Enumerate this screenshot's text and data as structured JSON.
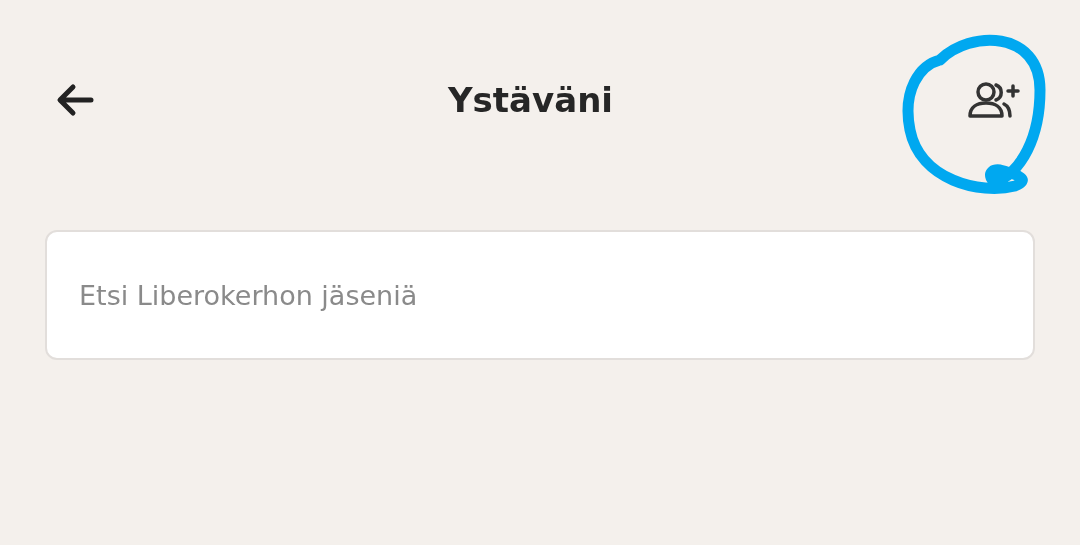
{
  "header": {
    "title": "Ystäväni"
  },
  "search": {
    "placeholder": "Etsi Liberokerhon jäseniä"
  },
  "annotation": {
    "kind": "circle"
  }
}
